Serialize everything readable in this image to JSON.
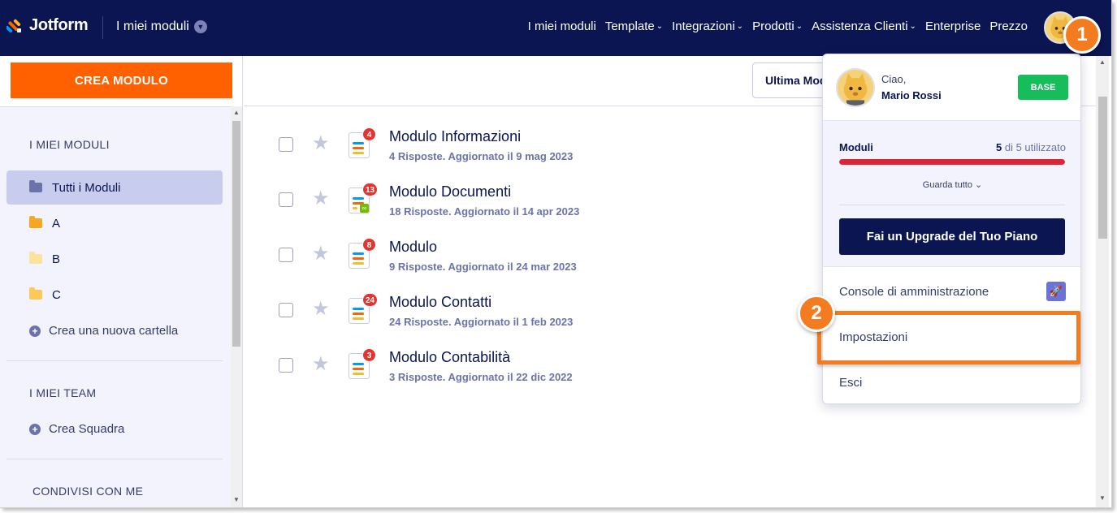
{
  "brand": {
    "name": "Jotform"
  },
  "header": {
    "workspace_label": "I miei moduli",
    "nav": [
      {
        "label": "I miei moduli",
        "caret": false
      },
      {
        "label": "Template",
        "caret": true
      },
      {
        "label": "Integrazioni",
        "caret": true
      },
      {
        "label": "Prodotti",
        "caret": true
      },
      {
        "label": "Assistenza Clienti",
        "caret": true
      },
      {
        "label": "Enterprise",
        "caret": false
      },
      {
        "label": "Prezzo",
        "caret": false
      }
    ]
  },
  "sidebar": {
    "create_label": "CREA MODULO",
    "my_forms_title": "I MIEI MODULI",
    "items": [
      {
        "label": "Tutti i Moduli",
        "color": "#6c73a8",
        "active": true
      },
      {
        "label": "A",
        "color": "#f5a623",
        "active": false
      },
      {
        "label": "B",
        "color": "#fbe39b",
        "active": false
      },
      {
        "label": "C",
        "color": "#fbc85a",
        "active": false
      }
    ],
    "new_folder_label": "Crea una nuova cartella",
    "teams_title": "I MIEI TEAM",
    "create_team_label": "Crea Squadra",
    "shared_title": "CONDIVISI CON ME"
  },
  "toolbar": {
    "sort_label": "Ultima Modifica"
  },
  "forms": [
    {
      "title": "Modulo Informazioni",
      "meta": "4 Risposte. Aggiornato il 9 mag 2023",
      "badge": "4",
      "linked": false
    },
    {
      "title": "Modulo Documenti",
      "meta": "18 Risposte. Aggiornato il 14 apr 2023",
      "badge": "13",
      "linked": true
    },
    {
      "title": "Modulo",
      "meta": "9 Risposte. Aggiornato il 24 mar 2023",
      "badge": "8",
      "linked": false
    },
    {
      "title": "Modulo Contatti",
      "meta": "24 Risposte. Aggiornato il 1 feb 2023",
      "badge": "24",
      "linked": false
    },
    {
      "title": "Modulo Contabilità",
      "meta": "3 Risposte. Aggiornato il 22 dic 2022",
      "badge": "3",
      "linked": false
    }
  ],
  "account_menu": {
    "greeting": "Ciao,",
    "user_name": "Mario Rossi",
    "plan": "BASE",
    "usage": {
      "label": "Moduli",
      "used": "5",
      "suffix": "di 5 utilizzato",
      "fraction": 1.0,
      "see_all_label": "Guarda tutto"
    },
    "upgrade_label": "Fai un Upgrade del Tuo Piano",
    "admin_console_label": "Console di amministrazione",
    "settings_label": "Impostazioni",
    "logout_label": "Esci"
  },
  "annotations": {
    "step1": "1",
    "step2": "2"
  },
  "colors": {
    "nav_bg": "#0a1551",
    "primary_orange": "#ff6100",
    "plan_green": "#18bd5b",
    "usage_red": "#dc2536",
    "annotation_orange": "#f47c20"
  }
}
